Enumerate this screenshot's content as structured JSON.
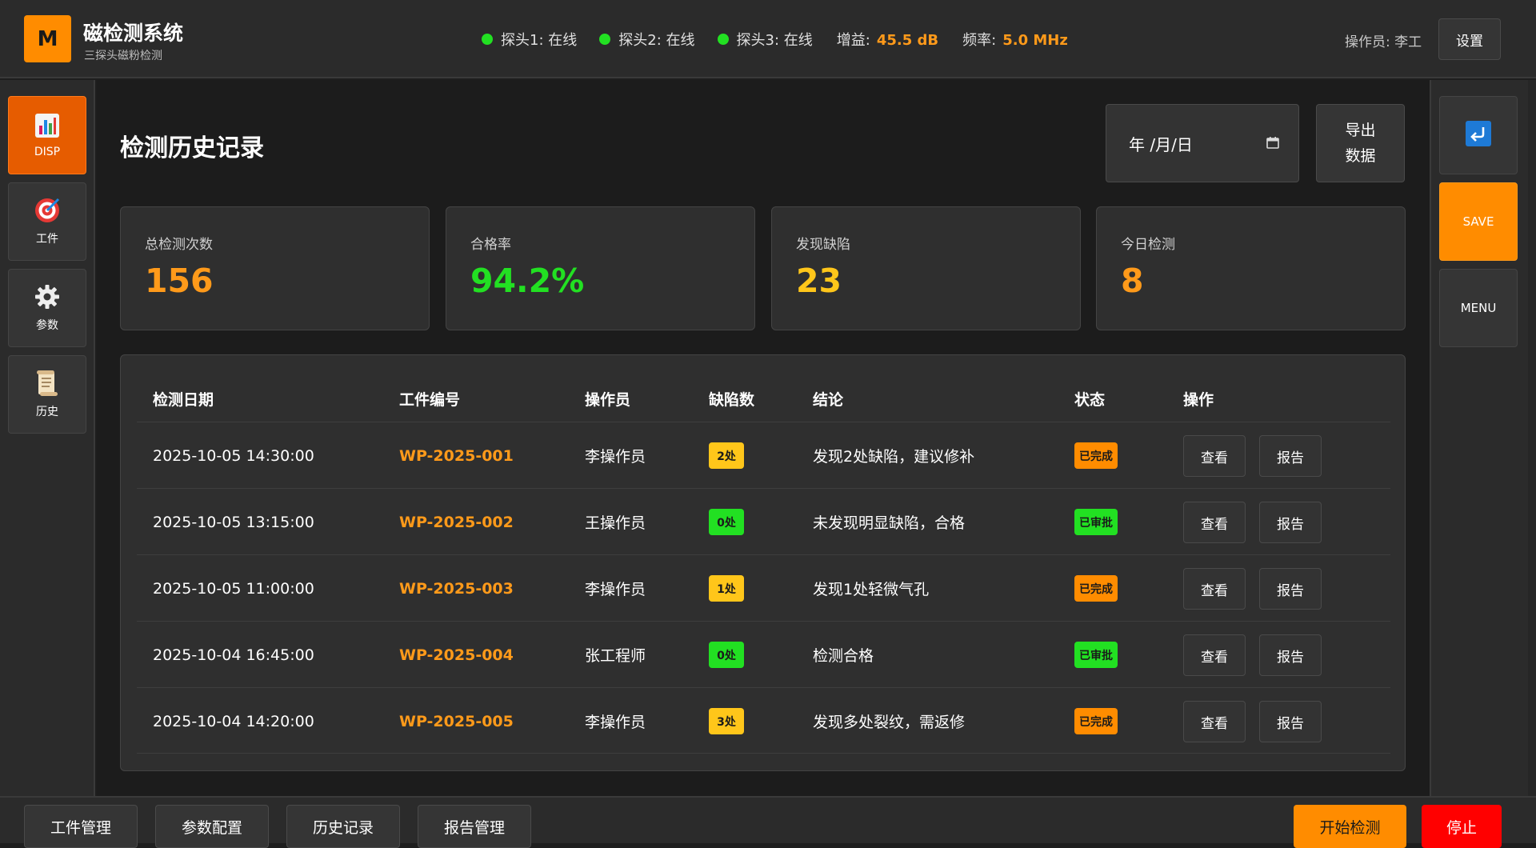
{
  "header": {
    "logo_letter": "M",
    "title": "磁检测系统",
    "subtitle": "三探头磁粉检测",
    "probes": [
      {
        "label": "探头1: 在线"
      },
      {
        "label": "探头2: 在线"
      },
      {
        "label": "探头3: 在线"
      }
    ],
    "gain_label": "增益:",
    "gain_value": "45.5 dB",
    "freq_label": "频率:",
    "freq_value": "5.0 MHz",
    "operator": "操作员: 李工",
    "settings_label": "设置"
  },
  "sidebar": {
    "items": [
      {
        "label": "DISP",
        "icon": "bar-chart-icon",
        "active": true
      },
      {
        "label": "工件",
        "icon": "target-icon"
      },
      {
        "label": "参数",
        "icon": "gear-icon"
      },
      {
        "label": "历史",
        "icon": "scroll-icon"
      }
    ]
  },
  "right_sidebar": {
    "return_icon": "return-icon",
    "save_label": "SAVE",
    "menu_label": "MENU"
  },
  "main": {
    "title": "检测历史记录",
    "date_placeholder": "年 /月/日",
    "export_label_line1": "导出",
    "export_label_line2": "数据",
    "stats": [
      {
        "label": "总检测次数",
        "value": "156",
        "color": "#ff9a1a"
      },
      {
        "label": "合格率",
        "value": "94.2%",
        "color": "#22e022"
      },
      {
        "label": "发现缺陷",
        "value": "23",
        "color": "#ffc61a"
      },
      {
        "label": "今日检测",
        "value": "8",
        "color": "#ff9a1a"
      }
    ],
    "table": {
      "headers": [
        "检测日期",
        "工件编号",
        "操作员",
        "缺陷数",
        "结论",
        "状态",
        "操作"
      ],
      "rows": [
        {
          "date": "2025-10-05 14:30:00",
          "wp": "WP-2025-001",
          "operator": "李操作员",
          "defects": "2处",
          "defect_color": "#ffc61a",
          "conclusion": "发现2处缺陷，建议修补",
          "status": "已完成",
          "status_color": "#ff8c00",
          "view": "查看",
          "report": "报告"
        },
        {
          "date": "2025-10-05 13:15:00",
          "wp": "WP-2025-002",
          "operator": "王操作员",
          "defects": "0处",
          "defect_color": "#22e022",
          "conclusion": "未发现明显缺陷，合格",
          "status": "已审批",
          "status_color": "#22e022",
          "view": "查看",
          "report": "报告"
        },
        {
          "date": "2025-10-05 11:00:00",
          "wp": "WP-2025-003",
          "operator": "李操作员",
          "defects": "1处",
          "defect_color": "#ffc61a",
          "conclusion": "发现1处轻微气孔",
          "status": "已完成",
          "status_color": "#ff8c00",
          "view": "查看",
          "report": "报告"
        },
        {
          "date": "2025-10-04 16:45:00",
          "wp": "WP-2025-004",
          "operator": "张工程师",
          "defects": "0处",
          "defect_color": "#22e022",
          "conclusion": "检测合格",
          "status": "已审批",
          "status_color": "#22e022",
          "view": "查看",
          "report": "报告"
        },
        {
          "date": "2025-10-04 14:20:00",
          "wp": "WP-2025-005",
          "operator": "李操作员",
          "defects": "3处",
          "defect_color": "#ffc61a",
          "conclusion": "发现多处裂纹，需返修",
          "status": "已完成",
          "status_color": "#ff8c00",
          "view": "查看",
          "report": "报告"
        }
      ]
    }
  },
  "footer": {
    "tabs": [
      "工件管理",
      "参数配置",
      "历史记录",
      "报告管理"
    ],
    "start_label": "开始检测",
    "stop_label": "停止"
  }
}
